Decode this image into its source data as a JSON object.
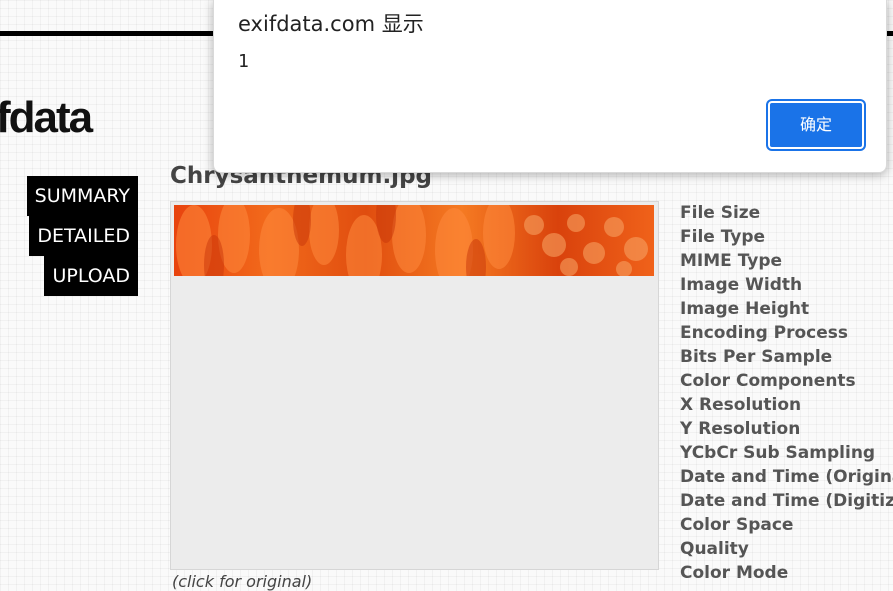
{
  "site": {
    "logo_text": "fdata"
  },
  "nav": {
    "items": [
      "SUMMARY",
      "DETAILED",
      "UPLOAD"
    ]
  },
  "file": {
    "title": "Chrysanthemum.jpg",
    "caption": "(click for original)"
  },
  "properties": [
    "File Size",
    "File Type",
    "MIME Type",
    "Image Width",
    "Image Height",
    "Encoding Process",
    "Bits Per Sample",
    "Color Components",
    "X Resolution",
    "Y Resolution",
    "YCbCr Sub Sampling",
    "Date and Time (Original)",
    "Date and Time (Digitized)",
    "Color Space",
    "Quality",
    "Color Mode"
  ],
  "dialog": {
    "title": "exifdata.com 显示",
    "message": "1",
    "ok_label": "确定"
  },
  "colors": {
    "accent": "#1a73e8",
    "nav_bg": "#000000"
  }
}
